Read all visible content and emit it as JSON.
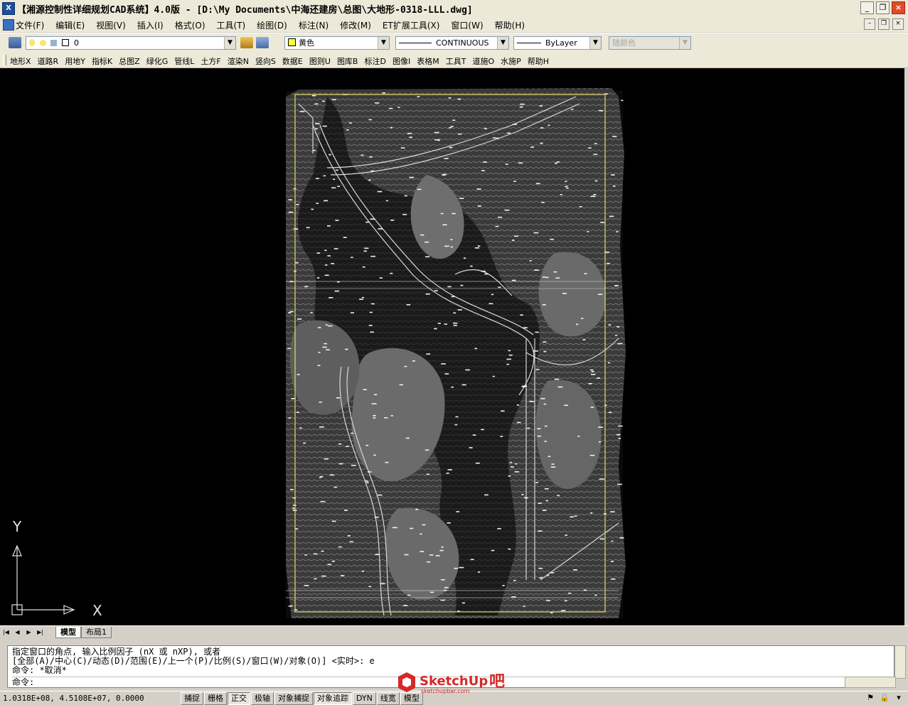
{
  "window": {
    "title": "【湘源控制性详细规划CAD系统】4.0版 - [D:\\My Documents\\中海还建房\\总图\\大地形-0318-LLL.dwg]",
    "controls": {
      "minimize": "_",
      "restore": "❐",
      "close": "×"
    },
    "mdi_controls": {
      "minimize": "–",
      "restore": "❐",
      "close": "×"
    }
  },
  "menu": {
    "items": [
      "文件(F)",
      "编辑(E)",
      "视图(V)",
      "插入(I)",
      "格式(O)",
      "工具(T)",
      "绘图(D)",
      "标注(N)",
      "修改(M)",
      "ET扩展工具(X)",
      "窗口(W)",
      "帮助(H)"
    ]
  },
  "layer_toolbar": {
    "layer_value": "0",
    "color_value": "黄色",
    "linetype_value": "CONTINUOUS",
    "lineweight_value": "ByLayer",
    "plotstyle_value": "随颜色",
    "colors": {
      "swatch": "#ffff33"
    }
  },
  "command_toolbar": {
    "items": [
      "地形X",
      "道路R",
      "用地Y",
      "指标K",
      "总图Z",
      "绿化G",
      "管线L",
      "土方F",
      "渲染N",
      "竖向S",
      "数据E",
      "图则U",
      "图库B",
      "标注D",
      "图像I",
      "表格M",
      "工具T",
      "道施O",
      "水施P",
      "帮助H"
    ]
  },
  "drawing": {
    "background": "#000000",
    "frame_color": "#e6d86a",
    "terrain_color": "#5a5a5a",
    "ucs": {
      "x_label": "X",
      "y_label": "Y"
    }
  },
  "tabs": {
    "nav": [
      "|◀",
      "◀",
      "▶",
      "▶|"
    ],
    "items": [
      "模型",
      "布局1"
    ]
  },
  "command_window": {
    "lines": [
      "指定窗口的角点, 输入比例因子 (nX 或 nXP), 或者",
      "[全部(A)/中心(C)/动态(D)/范围(E)/上一个(P)/比例(S)/窗口(W)/对象(O)] <实时>: e",
      "命令: *取消*"
    ],
    "prompt": "命令:"
  },
  "status_bar": {
    "coordinates": "1.0318E+08, 4.5108E+07, 0.0000",
    "toggles": [
      {
        "label": "捕捉",
        "on": false
      },
      {
        "label": "栅格",
        "on": false
      },
      {
        "label": "正交",
        "on": true
      },
      {
        "label": "极轴",
        "on": false
      },
      {
        "label": "对象捕捉",
        "on": false
      },
      {
        "label": "对象追踪",
        "on": true
      },
      {
        "label": "DYN",
        "on": false
      },
      {
        "label": "线宽",
        "on": false
      },
      {
        "label": "模型",
        "on": false
      }
    ]
  },
  "watermark": {
    "brand": "SketchUp",
    "suffix": "吧",
    "url": "sketchupbar.com"
  }
}
